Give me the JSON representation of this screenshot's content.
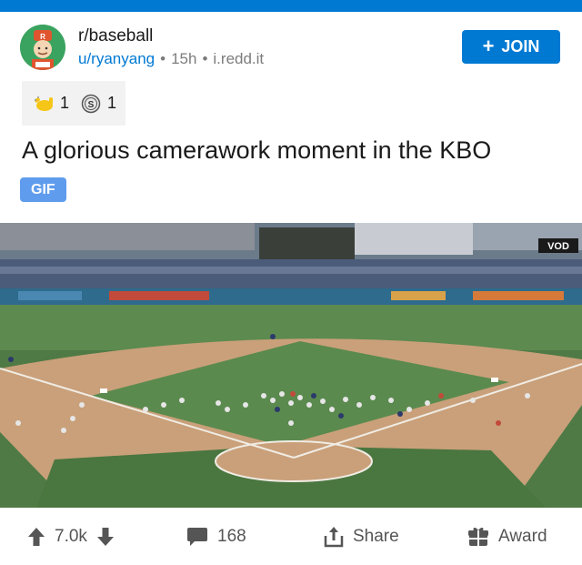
{
  "post": {
    "subreddit": "r/baseball",
    "username": "u/ryanyang",
    "age": "15h",
    "domain": "i.redd.it",
    "join_label": "JOIN",
    "title": "A glorious camerawork moment in the KBO",
    "flair": "GIF",
    "awards": [
      {
        "icon": "shaka-award-icon",
        "count": "1"
      },
      {
        "icon": "silver-coin-award-icon",
        "count": "1"
      }
    ],
    "media_badge": "VOD"
  },
  "actions": {
    "score": "7.0k",
    "comments": "168",
    "share_label": "Share",
    "award_label": "Award"
  },
  "colors": {
    "brand_blue": "#0079d3",
    "flair_blue": "#5f9ced"
  }
}
